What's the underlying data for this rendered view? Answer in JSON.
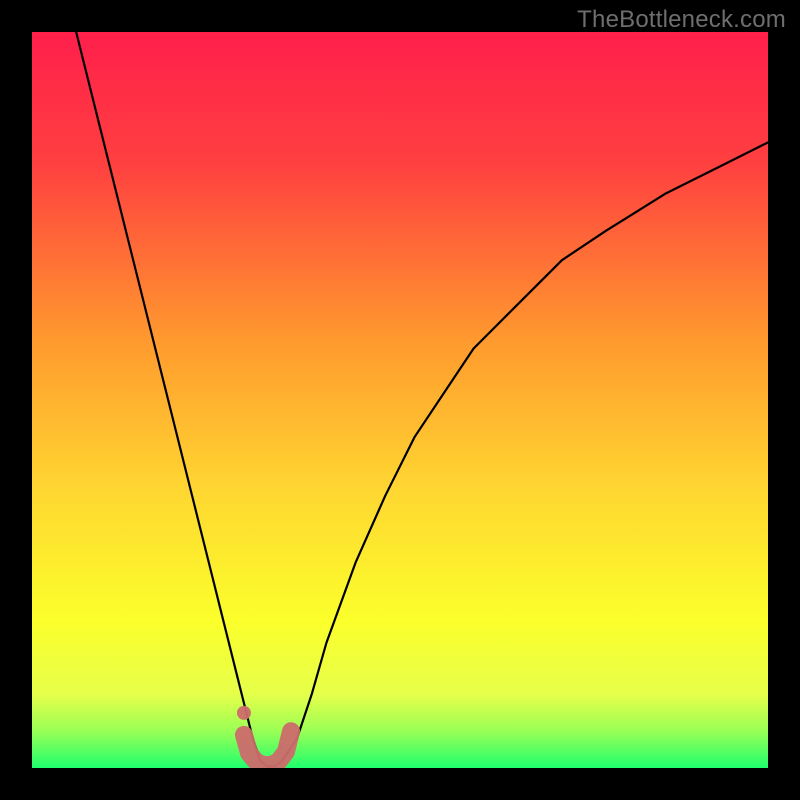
{
  "watermark": "TheBottleneck.com",
  "colors": {
    "gradient_top": "#ff1f4b",
    "gradient_mid1": "#ff7a2e",
    "gradient_mid2": "#ffd631",
    "gradient_mid3": "#fbff2b",
    "gradient_bottom": "#1fff6e",
    "curve": "#000000",
    "highlight": "#cc6c6c",
    "frame_bg": "#000000"
  },
  "chart_data": {
    "type": "line",
    "title": "",
    "xlabel": "",
    "ylabel": "",
    "xlim": [
      0,
      100
    ],
    "ylim": [
      0,
      100
    ],
    "series": [
      {
        "name": "bottleneck-curve",
        "x": [
          6,
          8,
          10,
          12,
          14,
          16,
          18,
          20,
          22,
          24,
          26,
          28,
          29,
          30,
          31,
          32,
          33,
          34,
          36,
          38,
          40,
          44,
          48,
          52,
          56,
          60,
          66,
          72,
          78,
          86,
          94,
          100
        ],
        "y": [
          100,
          92,
          84,
          76,
          68,
          60,
          52,
          44,
          36,
          28,
          20,
          12,
          8,
          4,
          1,
          0.2,
          0.2,
          1,
          4,
          10,
          17,
          28,
          37,
          45,
          51,
          57,
          63,
          69,
          73,
          78,
          82,
          85
        ]
      },
      {
        "name": "highlight-bottom",
        "x": [
          28.8,
          29.5,
          30.5,
          31.5,
          32.5,
          33.5,
          34.5,
          35.2
        ],
        "y": [
          4.5,
          2.0,
          0.8,
          0.4,
          0.4,
          0.9,
          2.2,
          5.0
        ]
      }
    ],
    "annotations": []
  }
}
